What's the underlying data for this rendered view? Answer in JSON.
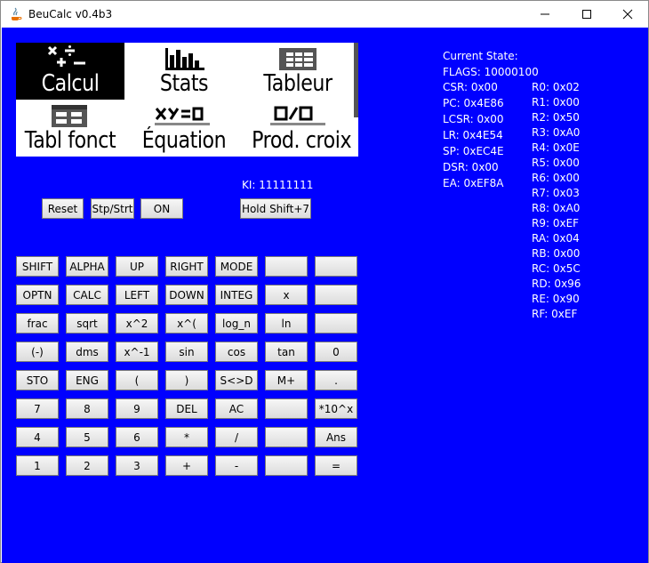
{
  "window": {
    "title": "BeuCalc v0.4b3"
  },
  "modes": [
    {
      "label": "Calcul",
      "icon": "calcul-icon",
      "selected": true
    },
    {
      "label": "Stats",
      "icon": "stats-icon",
      "selected": false
    },
    {
      "label": "Tableur",
      "icon": "tableur-icon",
      "selected": false
    },
    {
      "label": "Tabl fonct",
      "icon": "tabl-fonct-icon",
      "selected": false
    },
    {
      "label": "Équation",
      "icon": "equation-icon",
      "selected": false
    },
    {
      "label": "Prod. croix",
      "icon": "prod-croix-icon",
      "selected": false
    }
  ],
  "controls": {
    "reset": "Reset",
    "stpstrt": "Stp/Strt",
    "on": "ON",
    "hold": "Hold Shift+7"
  },
  "ki": "KI: 11111111",
  "keys": [
    [
      "SHIFT",
      "ALPHA",
      "UP",
      "RIGHT",
      "MODE",
      "",
      ""
    ],
    [
      "OPTN",
      "CALC",
      "LEFT",
      "DOWN",
      "INTEG",
      "x",
      ""
    ],
    [
      "frac",
      "sqrt",
      "x^2",
      "x^(",
      "log_n",
      "ln",
      ""
    ],
    [
      "(-)",
      "dms",
      "x^-1",
      "sin",
      "cos",
      "tan",
      "0"
    ],
    [
      "STO",
      "ENG",
      "(",
      ")",
      "S<>D",
      "M+",
      "."
    ],
    [
      "7",
      "8",
      "9",
      "DEL",
      "AC",
      "",
      "*10^x"
    ],
    [
      "4",
      "5",
      "6",
      "*",
      "/",
      "",
      "Ans"
    ],
    [
      "1",
      "2",
      "3",
      "+",
      "-",
      "",
      "="
    ]
  ],
  "state": {
    "title": "Current State:",
    "flags": "FLAGS: 10000100",
    "left": [
      "CSR: 0x00",
      "PC: 0x4E86",
      "LCSR: 0x00",
      "LR: 0x4E54",
      "SP: 0xEC4E",
      "DSR: 0x00",
      "EA: 0xEF8A"
    ],
    "right": [
      "R0: 0x02",
      "R1: 0x00",
      "R2: 0x50",
      "R3: 0xA0",
      "R4: 0x0E",
      "R5: 0x00",
      "R6: 0x00",
      "R7: 0x03",
      "R8: 0xA0",
      "R9: 0xEF",
      "RA: 0x04",
      "RB: 0x00",
      "RC: 0x5C",
      "RD: 0x96",
      "RE: 0x90",
      "RF: 0xEF"
    ]
  },
  "colors": {
    "client_bg": "#0000ff",
    "panel_bg": "#ffffff",
    "text_on_bg": "#ffffff"
  }
}
